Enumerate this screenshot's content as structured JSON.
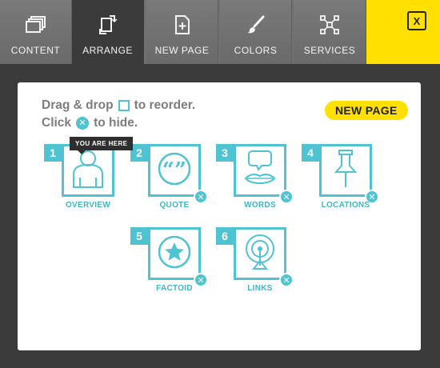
{
  "toolbar": {
    "tabs": [
      {
        "label": "CONTENT",
        "icon": "stack-pages-icon"
      },
      {
        "label": "ARRANGE",
        "icon": "arrange-rotate-icon",
        "active": true
      },
      {
        "label": "NEW PAGE",
        "icon": "new-page-plus-icon"
      },
      {
        "label": "COLORS",
        "icon": "paintbrush-icon"
      },
      {
        "label": "SERVICES",
        "icon": "services-nodes-icon"
      }
    ],
    "close_label": "X"
  },
  "panel": {
    "line1_pre": "Drag & drop",
    "line1_post": "to reorder.",
    "line2_pre": "Click",
    "line2_post": "to hide.",
    "hide_glyph": "✕",
    "new_page_button": "NEW PAGE",
    "tooltip": "YOU ARE HERE"
  },
  "pages": [
    {
      "num": "1",
      "label": "OVERVIEW",
      "icon": "person-icon"
    },
    {
      "num": "2",
      "label": "QUOTE",
      "icon": "quote-icon"
    },
    {
      "num": "3",
      "label": "WORDS",
      "icon": "speech-lips-icon"
    },
    {
      "num": "4",
      "label": "LOCATIONS",
      "icon": "pushpin-icon"
    },
    {
      "num": "5",
      "label": "FACTOID",
      "icon": "star-icon"
    },
    {
      "num": "6",
      "label": "LINKS",
      "icon": "antenna-icon"
    }
  ],
  "colors": {
    "accent": "#4fc3d1",
    "yellow": "#ffe000",
    "toolbar": "#717171",
    "bg": "#3b3b3b"
  }
}
